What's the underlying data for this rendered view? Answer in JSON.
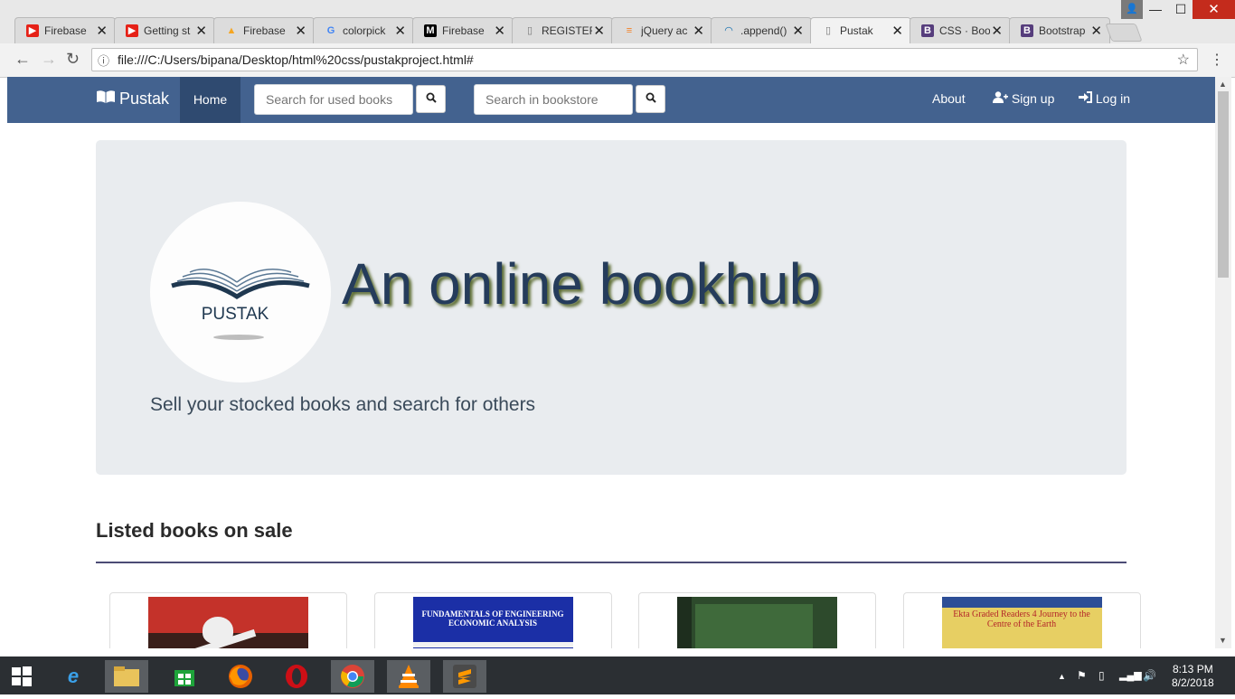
{
  "browser": {
    "tabs": [
      {
        "title": "Firebase",
        "icon": "youtube-icon",
        "color": "#e62117"
      },
      {
        "title": "Getting st",
        "icon": "youtube-icon",
        "color": "#e62117"
      },
      {
        "title": "Firebase",
        "icon": "firebase-icon",
        "color": "#f5a623"
      },
      {
        "title": "colorpick",
        "icon": "google-icon",
        "color": "#4285f4"
      },
      {
        "title": "Firebase",
        "icon": "medium-icon",
        "color": "#000000"
      },
      {
        "title": "REGISTER",
        "icon": "page-icon",
        "color": "#777777"
      },
      {
        "title": "jQuery ac",
        "icon": "stackoverflow-icon",
        "color": "#f48024"
      },
      {
        "title": ".append()",
        "icon": "jquery-icon",
        "color": "#0769ad"
      },
      {
        "title": "Pustak",
        "icon": "page-icon",
        "color": "#777777"
      },
      {
        "title": "CSS · Boo",
        "icon": "bootstrap-icon",
        "color": "#563d7c"
      },
      {
        "title": "Bootstrap",
        "icon": "bootstrap-icon",
        "color": "#563d7c"
      }
    ],
    "url": "file:///C:/Users/bipana/Desktop/html%20css/pustakproject.html#"
  },
  "navbar": {
    "brand": "Pustak",
    "home": "Home",
    "search_used_placeholder": "Search for used books",
    "search_store_placeholder": "Search in bookstore",
    "about": "About",
    "signup": "Sign up",
    "login": "Log in",
    "bg_color": "#43628f"
  },
  "hero": {
    "logo_text": "PUSTAK",
    "headline": "An online bookhub",
    "lead": "Sell your stocked books and search for others"
  },
  "listing": {
    "title": "Listed books on sale",
    "books": [
      {
        "cover_text": "",
        "bg": "#3a1f1a"
      },
      {
        "cover_text": "FUNDAMENTALS OF ENGINEERING ECONOMIC ANALYSIS",
        "bg": "#1b2fa6"
      },
      {
        "cover_text": "",
        "bg": "#2d4a2c"
      },
      {
        "cover_text": "Ekta Graded Readers 4 Journey to the Centre of the Earth",
        "bg": "#e7cf63"
      }
    ]
  },
  "taskbar": {
    "time": "8:13 PM",
    "date": "8/2/2018"
  }
}
